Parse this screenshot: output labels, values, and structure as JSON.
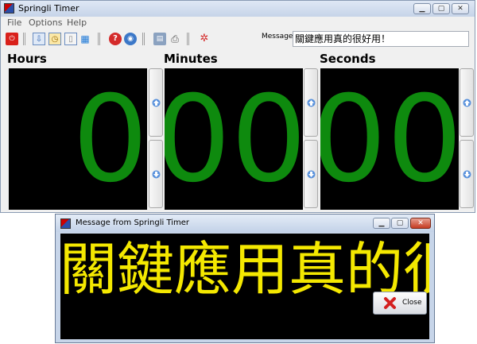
{
  "main_window": {
    "title": "Springli Timer",
    "controls": {
      "minimize": "▁",
      "maximize": "▢",
      "close": "✕"
    },
    "menu": [
      "File",
      "Options",
      "Help"
    ],
    "message_label": "Message",
    "message_value": "關鍵應用真的很好用！",
    "sections": [
      {
        "label": "Hours",
        "value": "00"
      },
      {
        "label": "Minutes",
        "value": "00"
      },
      {
        "label": "Seconds",
        "value": "00"
      }
    ]
  },
  "message_window": {
    "title": "Message from Springli Timer",
    "controls": {
      "minimize": "▁",
      "maximize": "▢",
      "close": "✕"
    },
    "message": "關鍵應用真的很好用！",
    "close_label": "Close"
  },
  "colors": {
    "digit_color": "#0e8a0e",
    "message_text_color": "#f4e800",
    "display_background": "#000000"
  }
}
